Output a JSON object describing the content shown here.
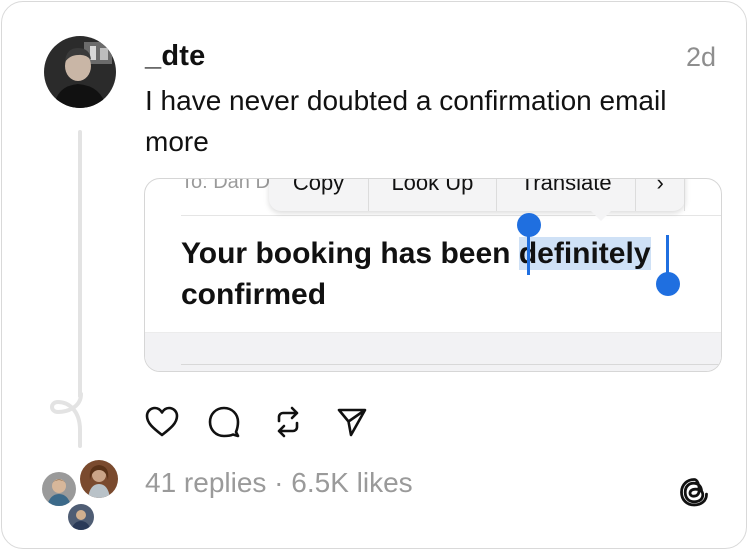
{
  "post": {
    "username": "_dte",
    "time": "2d",
    "text": "I have never doubted a confirmation email more"
  },
  "media": {
    "ghost_text": "To: Dan D",
    "context_menu": {
      "items": [
        "Copy",
        "Look Up",
        "Translate",
        "›"
      ]
    },
    "booking_prefix": "Your booking has been ",
    "booking_selected": "definitely",
    "booking_suffix": " confirmed",
    "selection_color": "#1f6fe0"
  },
  "actions": {
    "like": "heart-icon",
    "reply": "comment-icon",
    "repost": "repost-icon",
    "share": "send-icon"
  },
  "stats": {
    "text": "41 replies · 6.5K likes"
  }
}
